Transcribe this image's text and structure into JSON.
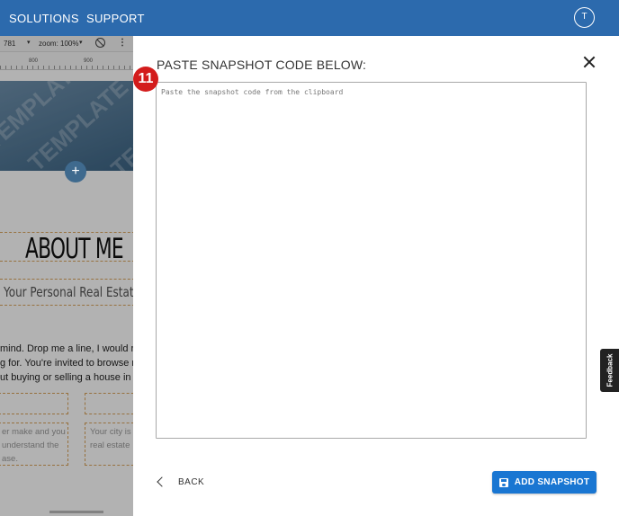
{
  "topnav": {
    "items": [
      "SOLUTIONS",
      "SUPPORT"
    ],
    "avatar_initial": "T"
  },
  "editor": {
    "toolbar": {
      "width_value": "781",
      "zoom_label": "zoom: 100%"
    },
    "ruler": {
      "marks": [
        "800",
        "900"
      ]
    },
    "hero_watermark": "TEMPLATE",
    "heading": "ABOUT ME",
    "subtitle": "Your Personal Real Estate Ag",
    "paragraph_lines": [
      "mind. Drop me a line, I would rea",
      "g for. You're invited to browse my",
      "ut buying or selling a house in th"
    ],
    "field_placeholders": {
      "left_lines": [
        "er make and you",
        "understand the",
        "ase."
      ],
      "right_lines": [
        "Your city is",
        "real estate"
      ]
    }
  },
  "modal": {
    "title": "PASTE SNAPSHOT CODE BELOW:",
    "step_number": "11",
    "textarea": {
      "placeholder": "Paste the snapshot code from the clipboard",
      "value": ""
    },
    "back_label": "BACK",
    "add_label": "ADD SNAPSHOT"
  },
  "feedback": {
    "label": "Feedback"
  },
  "colors": {
    "topbar": "#2c6aad",
    "primary_button": "#1976d2",
    "step_badge": "#d31c1c"
  }
}
